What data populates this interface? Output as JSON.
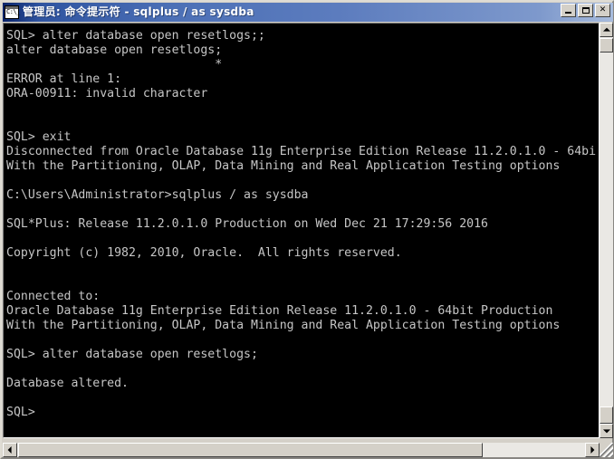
{
  "window": {
    "title": "管理员: 命令提示符 - sqlplus  / as sysdba",
    "icon": "console-icon",
    "colors": {
      "titlebar_start": "#0a246a",
      "titlebar_end": "#a8bcdd",
      "console_bg": "#000000",
      "console_fg": "#c6c6c6",
      "chrome": "#d4d0c8"
    },
    "buttons": {
      "minimize": "_",
      "maximize": "□",
      "close": "✕"
    }
  },
  "terminal": {
    "text": "SQL> alter database open resetlogs;;\nalter database open resetlogs;\n                             *\nERROR at line 1:\nORA-00911: invalid character\n\n\nSQL> exit\nDisconnected from Oracle Database 11g Enterprise Edition Release 11.2.0.1.0 - 64bi\nWith the Partitioning, OLAP, Data Mining and Real Application Testing options\n\nC:\\Users\\Administrator>sqlplus / as sysdba\n\nSQL*Plus: Release 11.2.0.1.0 Production on Wed Dec 21 17:29:56 2016\n\nCopyright (c) 1982, 2010, Oracle.  All rights reserved.\n\n\nConnected to:\nOracle Database 11g Enterprise Edition Release 11.2.0.1.0 - 64bit Production\nWith the Partitioning, OLAP, Data Mining and Real Application Testing options\n\nSQL> alter database open resetlogs;\n\nDatabase altered.\n\nSQL>",
    "lines": [
      "SQL> alter database open resetlogs;;",
      "alter database open resetlogs;",
      "                             *",
      "ERROR at line 1:",
      "ORA-00911: invalid character",
      "",
      "",
      "SQL> exit",
      "Disconnected from Oracle Database 11g Enterprise Edition Release 11.2.0.1.0 - 64bi",
      "With the Partitioning, OLAP, Data Mining and Real Application Testing options",
      "",
      "C:\\Users\\Administrator>sqlplus / as sysdba",
      "",
      "SQL*Plus: Release 11.2.0.1.0 Production on Wed Dec 21 17:29:56 2016",
      "",
      "Copyright (c) 1982, 2010, Oracle.  All rights reserved.",
      "",
      "",
      "Connected to:",
      "Oracle Database 11g Enterprise Edition Release 11.2.0.1.0 - 64bit Production",
      "With the Partitioning, OLAP, Data Mining and Real Application Testing options",
      "",
      "SQL> alter database open resetlogs;",
      "",
      "Database altered.",
      "",
      "SQL>"
    ],
    "prompt": "SQL>",
    "cursor": "_"
  },
  "scrollbars": {
    "vertical": {
      "up_arrow": "▲",
      "down_arrow": "▼"
    },
    "horizontal": {
      "left_arrow": "◀",
      "right_arrow": "▶"
    }
  }
}
